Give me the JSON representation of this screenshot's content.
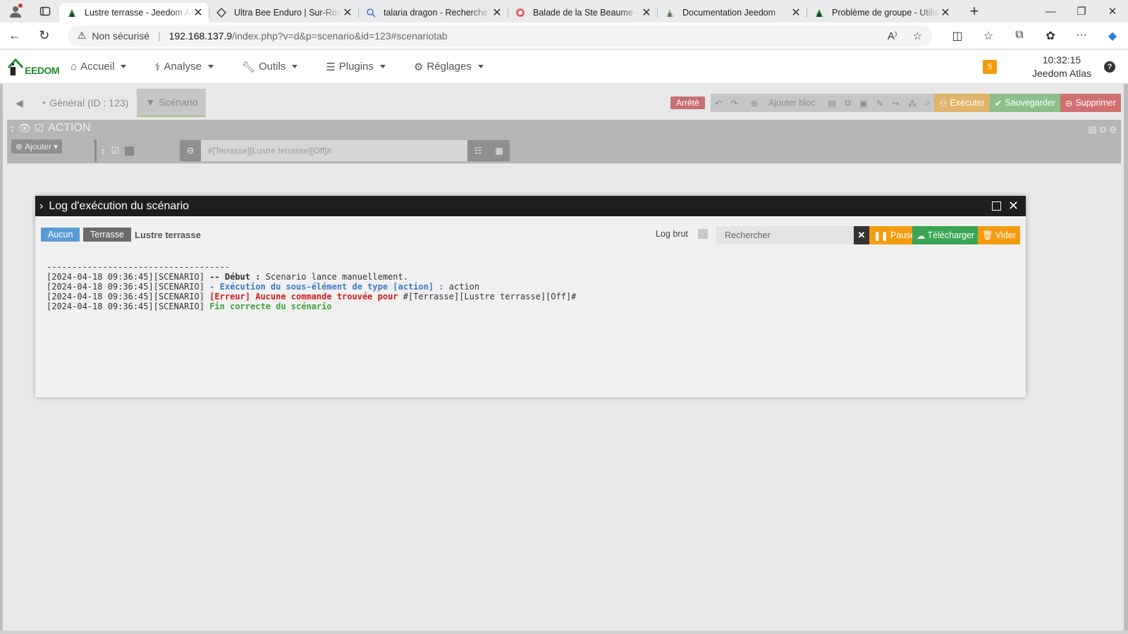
{
  "browser": {
    "tabs": [
      {
        "title": "Lustre terrasse - Jeedom Atlas",
        "active": true,
        "favicon": "jeedom-icon"
      },
      {
        "title": "Ultra Bee Enduro | Sur-Ron motorcycles",
        "active": false,
        "favicon": "diamond-icon"
      },
      {
        "title": "talaria dragon - Recherche",
        "active": false,
        "favicon": "search-icon"
      },
      {
        "title": "Balade de la Ste Beaume - Enduro",
        "active": false,
        "favicon": "spiral-icon"
      },
      {
        "title": "Documentation Jeedom",
        "active": false,
        "favicon": "jeedom-icon"
      },
      {
        "title": "Problème de groupe - Utilisateurs",
        "active": false,
        "favicon": "jeedom-icon"
      }
    ],
    "address": {
      "security": "Non sécurisé",
      "host": "192.168.137.9",
      "path": "/index.php?v=d&p=scenario&id=123#scenariotab"
    }
  },
  "jeedom": {
    "logo_text": "EEDOM",
    "menu": [
      {
        "label": "Accueil",
        "icon": "home-icon"
      },
      {
        "label": "Analyse",
        "icon": "stethoscope-icon"
      },
      {
        "label": "Outils",
        "icon": "wrench-icon"
      },
      {
        "label": "Plugins",
        "icon": "list-icon"
      },
      {
        "label": "Réglages",
        "icon": "gear-icon"
      }
    ],
    "badge": "5",
    "time": "10:32:15",
    "box_name": "Jeedom Atlas"
  },
  "scenario": {
    "tab_general": "Général (ID : 123)",
    "tab_scenario": "Scénario",
    "status": "Arrêté",
    "toolbar": {
      "add_block": "Ajouter bloc",
      "execute": "Exécuter",
      "save": "Sauvegarder",
      "delete": "Supprimer"
    },
    "block_title": "ACTION",
    "add_label": "Ajouter",
    "command_value": "#[Terrasse][Lustre terrasse][Off]#"
  },
  "modal": {
    "title": "Log d'exécution du scénario",
    "filter_none": "Aucun",
    "filter_object": "Terrasse",
    "filter_equipment": "Lustre terrasse",
    "raw_log_label": "Log brut",
    "search_placeholder": "Rechercher",
    "pause_label": "Pause",
    "download_label": "Télécharger",
    "clear_label": "Vider",
    "log": {
      "separator": "------------------------------------",
      "line1_prefix": "[2024-04-18 09:36:45][SCENARIO]",
      "line1_keyword": "-- Début :",
      "line1_text": "Scenario lance manuellement.",
      "line2_prefix": "[2024-04-18 09:36:45][SCENARIO]",
      "line2_keyword": "- Exécution du sous-élément de type [action] :",
      "line2_text": "action",
      "line3_prefix": "[2024-04-18 09:36:45][SCENARIO]",
      "line3_keyword": "[Erreur] Aucune commande trouvée pour",
      "line3_text": "#[Terrasse][Lustre terrasse][Off]#",
      "line4_prefix": "[2024-04-18 09:36:45][SCENARIO]",
      "line4_keyword": "Fin correcte du scénario"
    }
  },
  "colors": {
    "jeedom_green": "#1a8c2a",
    "warning": "#f39c12",
    "success": "#3aa655",
    "danger": "#d11c1c",
    "info": "#5b9bd5"
  }
}
